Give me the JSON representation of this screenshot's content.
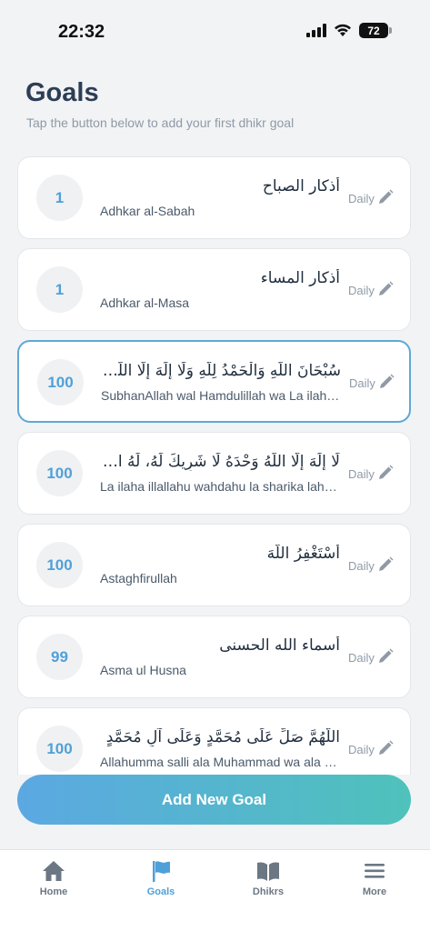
{
  "status_bar": {
    "time": "22:32",
    "battery": "72"
  },
  "header": {
    "title": "Goals",
    "subtitle": "Tap the button below to add your first dhikr goal"
  },
  "goals": [
    {
      "count": "1",
      "arabic": "أذكار الصباح",
      "latin": "Adhkar al-Sabah",
      "frequency": "Daily",
      "selected": false
    },
    {
      "count": "1",
      "arabic": "أذكار المساء",
      "latin": "Adhkar al-Masa",
      "frequency": "Daily",
      "selected": false
    },
    {
      "count": "100",
      "arabic": "سُبْحَانَ اللَّهِ وَالْحَمْدُ لِلَّهِ وَلَا إِلَهَ إِلَّا اللَّهُ وَاللَّهُ أَكْبَرُ",
      "latin": "SubhanAllah wal Hamdulillah wa La ilaha illallahu wallahu akbar",
      "frequency": "Daily",
      "selected": true
    },
    {
      "count": "100",
      "arabic": "لَا إِلَهَ إِلَّا اللَّهُ وَحْدَهُ لَا شَرِيكَ لَهُ، لَهُ الْمُلْكُ",
      "latin": "La ilaha illallahu wahdahu la sharika lahu lahul mulk",
      "frequency": "Daily",
      "selected": false
    },
    {
      "count": "100",
      "arabic": "أَسْتَغْفِرُ اللَّهَ",
      "latin": "Astaghfirullah",
      "frequency": "Daily",
      "selected": false
    },
    {
      "count": "99",
      "arabic": "أسماء الله الحسنى",
      "latin": "Asma ul Husna",
      "frequency": "Daily",
      "selected": false
    },
    {
      "count": "100",
      "arabic": "اللَّهُمَّ صَلِّ عَلَى مُحَمَّدٍ وَعَلَى آلِ مُحَمَّدٍ",
      "latin": "Allahumma salli ala Muhammad wa ala ali Muhammad",
      "frequency": "Daily",
      "selected": false
    }
  ],
  "add_button": {
    "label": "Add New Goal"
  },
  "tabs": [
    {
      "label": "Home",
      "icon": "home-icon",
      "active": false
    },
    {
      "label": "Goals",
      "icon": "flag-icon",
      "active": true
    },
    {
      "label": "Dhikrs",
      "icon": "book-icon",
      "active": false
    },
    {
      "label": "More",
      "icon": "menu-icon",
      "active": false
    }
  ],
  "colors": {
    "accent": "#4fa0d8",
    "gradient_start": "#5ba8e2",
    "gradient_end": "#4fc2bb",
    "title": "#2c3e55",
    "muted": "#8f9aa6"
  }
}
